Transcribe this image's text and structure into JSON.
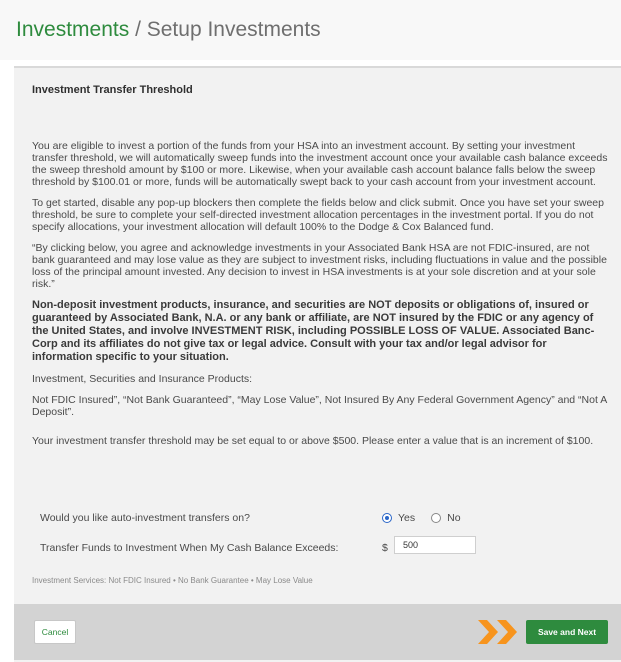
{
  "header": {
    "title_main": "Investments",
    "separator": "/",
    "title_sub": "Setup Investments"
  },
  "panel": {
    "title": "Investment Transfer Threshold",
    "paragraphs": [
      "You are eligible to invest a portion of the funds from your HSA into an investment account. By setting your investment transfer threshold, we will automatically sweep funds into the investment account once your available cash balance exceeds the sweep threshold amount by $100 or more. Likewise, when your available cash account balance falls below the sweep threshold by $100.01 or more, funds will be automatically swept back to your cash account from your investment account.",
      "To get started, disable any pop-up blockers then complete the fields below and click submit. Once you have set your sweep threshold, be sure to complete your self-directed investment allocation percentages in the investment portal. If you do not specify allocations, your investment allocation will default 100% to the Dodge & Cox Balanced fund.",
      "“By clicking below, you agree and acknowledge investments in your Associated Bank HSA are not FDIC-insured, are not bank guaranteed and may lose value as they are subject to investment risks, including fluctuations in value and the possible loss of the principal amount invested. Any decision to invest in HSA investments is at your sole discretion and at your sole risk.”",
      "Non-deposit investment products, insurance, and securities are NOT deposits or obligations of, insured or guaranteed by Associated Bank, N.A. or any bank or affiliate, are NOT insured by the FDIC or any agency of the United States, and involve INVESTMENT RISK, including POSSIBLE LOSS OF VALUE. Associated Banc-Corp and its affiliates do not give tax or legal advice. Consult with your tax and/or legal advisor for information specific to your situation.",
      "Investment, Securities and Insurance Products:",
      "Not FDIC Insured”, “Not Bank Guaranteed”, “May Lose Value”, Not Insured By Any Federal Government Agency” and “Not A Deposit”.",
      "Your investment transfer threshold may be set equal to or above $500. Please enter a value that is an increment of $100."
    ]
  },
  "form": {
    "auto_question": "Would you like auto-investment transfers on?",
    "yes_label": "Yes",
    "no_label": "No",
    "selected": "Yes",
    "threshold_label": "Transfer Funds to Investment When My Cash Balance Exceeds:",
    "currency": "$",
    "threshold_value": "500"
  },
  "disclaimer": "Investment Services: Not FDIC Insured • No Bank Guarantee • May Lose Value",
  "footer": {
    "cancel_label": "Cancel",
    "next_label": "Save and Next"
  },
  "colors": {
    "brand_green": "#2e8b3e",
    "arrow_orange": "#f7941d",
    "radio_blue": "#2a66c8"
  }
}
